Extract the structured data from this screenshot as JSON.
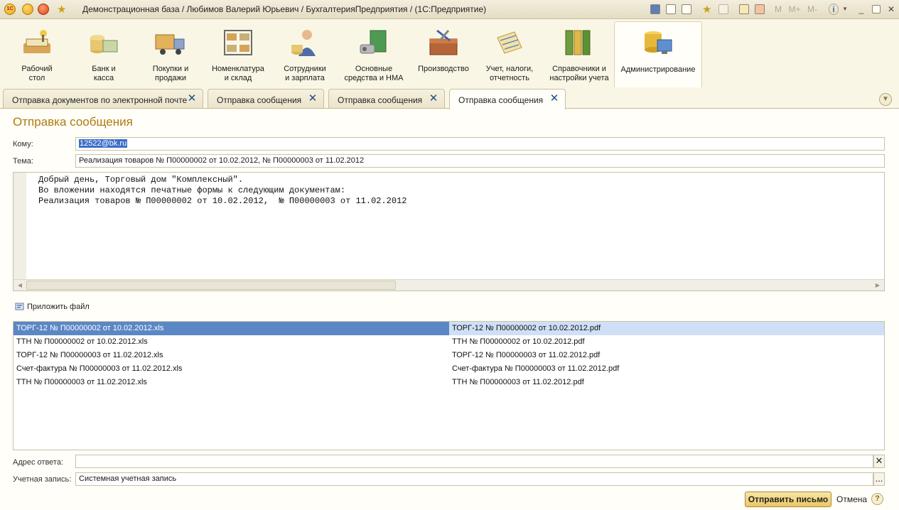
{
  "window": {
    "title": "Демонстрационная база / Любимов Валерий Юрьевич / БухгалтерияПредприятия /  (1С:Предприятие)",
    "logo_text": "1С",
    "tool_m": "M",
    "tool_mplus": "M+",
    "tool_mminus": "M-",
    "tool_info": "i",
    "tool_min": "_",
    "tool_close": "✕"
  },
  "sections": [
    {
      "line1": "Рабочий",
      "line2": "стол",
      "icon": "desktop-icon"
    },
    {
      "line1": "Банк и",
      "line2": "касса",
      "icon": "bank-icon"
    },
    {
      "line1": "Покупки и",
      "line2": "продажи",
      "icon": "truck-icon"
    },
    {
      "line1": "Номенклатура",
      "line2": "и склад",
      "icon": "warehouse-icon"
    },
    {
      "line1": "Сотрудники",
      "line2": "и зарплата",
      "icon": "employee-icon"
    },
    {
      "line1": "Основные",
      "line2": "средства и НМА",
      "icon": "assets-icon"
    },
    {
      "line1": "Производство",
      "line2": "",
      "icon": "toolbox-icon"
    },
    {
      "line1": "Учет, налоги,",
      "line2": "отчетность",
      "icon": "reports-icon"
    },
    {
      "line1": "Справочники и",
      "line2": "настройки учета",
      "icon": "binders-icon"
    },
    {
      "line1": "Администрирование",
      "line2": "",
      "icon": "admin-icon"
    }
  ],
  "tabs": [
    {
      "label": "Отправка документов по электронной почте"
    },
    {
      "label": "Отправка сообщения"
    },
    {
      "label": "Отправка сообщения"
    },
    {
      "label": "Отправка сообщения",
      "active": true
    }
  ],
  "form": {
    "title": "Отправка сообщения",
    "to_label": "Кому:",
    "to_value": "12522@bk.ru",
    "subject_label": "Тема:",
    "subject_value": "Реализация товаров № П00000002 от 10.02.2012,  № П00000003 от 11.02.2012",
    "body": "Добрый день, Торговый дом \"Комплексный\".\nВо вложении находятся печатные формы к следующим документам:\nРеализация товаров № П00000002 от 10.02.2012,  № П00000003 от 11.02.2012",
    "attach_label": "Приложить файл",
    "files_left": [
      "ТОРГ-12  № П00000002 от 10.02.2012.xls",
      "ТТН  № П00000002 от 10.02.2012.xls",
      "ТОРГ-12  № П00000003 от 11.02.2012.xls",
      "Счет-фактура  № П00000003 от 11.02.2012.xls",
      "ТТН  № П00000003 от 11.02.2012.xls"
    ],
    "files_right": [
      "ТОРГ-12  № П00000002 от 10.02.2012.pdf",
      "ТТН  № П00000002 от 10.02.2012.pdf",
      "ТОРГ-12  № П00000003 от 11.02.2012.pdf",
      "Счет-фактура  № П00000003 от 11.02.2012.pdf",
      "ТТН  № П00000003 от 11.02.2012.pdf"
    ],
    "reply_label": "Адрес ответа:",
    "reply_value": "",
    "account_label": "Учетная запись:",
    "account_value": "Системная учетная запись",
    "account_button": "...",
    "clear_button": "✕",
    "send_button": "Отправить письмо",
    "cancel_link": "Отмена",
    "help_button": "?",
    "tabs_menu": "▼"
  },
  "colors": {
    "accent": "#b07a10",
    "selection": "#5b87c5",
    "selection_light": "#cfe0f6",
    "background": "#fffef8"
  }
}
